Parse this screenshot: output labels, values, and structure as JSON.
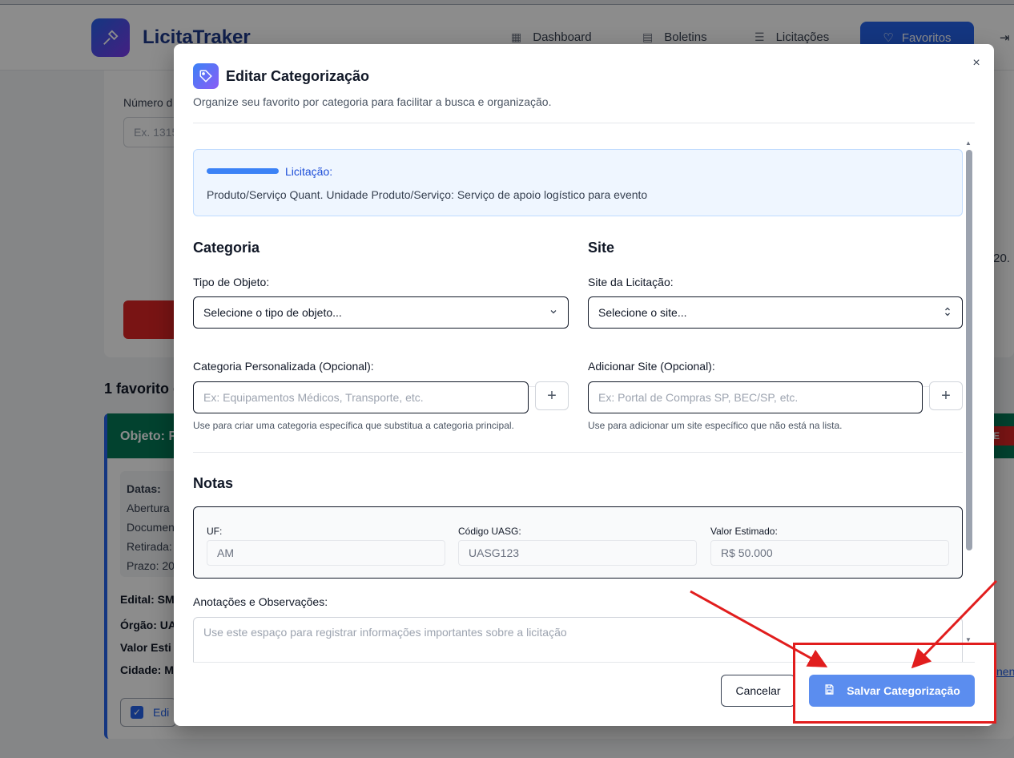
{
  "background": {
    "brand": "LicitaTraker",
    "nav": [
      {
        "icon": "dashboard-icon",
        "label": "Dashboard"
      },
      {
        "icon": "document-icon",
        "label": "Boletins"
      },
      {
        "icon": "list-icon",
        "label": "Licitações"
      }
    ],
    "favorites_label": "Favoritos",
    "filter_label": "Número d",
    "filter_placeholder": "Ex. 1315",
    "date_partial": "/20.",
    "count_text": "1 favorito e",
    "card_header": "Objeto: F",
    "badge": "E",
    "datas_lines": [
      "Datas:",
      "Abertura",
      "Documen",
      "Retirada:",
      "Prazo: 20"
    ],
    "fields": [
      "Edital: SM",
      "Órgão: UA",
      "Valor Esti",
      "Cidade: M"
    ],
    "edit_label": "Edi",
    "link_partial": "nen"
  },
  "modal": {
    "title": "Editar Categorização",
    "subtitle": "Organize seu favorito por categoria para facilitar a busca e organização.",
    "close": "×",
    "info": {
      "label": "Licitação:",
      "description": "Produto/Serviço Quant. Unidade Produto/Serviço: Serviço de apoio logístico para evento"
    },
    "categoria": {
      "heading": "Categoria",
      "tipo_label": "Tipo de Objeto:",
      "tipo_value": "Selecione o tipo de objeto...",
      "custom_label": "Categoria Personalizada (Opcional):",
      "custom_placeholder": "Ex: Equipamentos Médicos, Transporte, etc.",
      "custom_hint": "Use para criar uma categoria específica que substitua a categoria principal."
    },
    "site": {
      "heading": "Site",
      "site_label": "Site da Licitação:",
      "site_value": "Selecione o site...",
      "add_label": "Adicionar Site (Opcional):",
      "add_placeholder": "Ex: Portal de Compras SP, BEC/SP, etc.",
      "add_hint": "Use para adicionar um site específico que não está na lista."
    },
    "notas": {
      "heading": "Notas",
      "uf_label": "UF:",
      "uf_value": "AM",
      "uasg_label": "Código UASG:",
      "uasg_value": "UASG123",
      "valor_label": "Valor Estimado:",
      "valor_value": "R$ 50.000",
      "obs_label": "Anotações e Observações:",
      "obs_placeholder": "Use este espaço para registrar informações importantes sobre a licitação"
    },
    "footer": {
      "cancel": "Cancelar",
      "save": "Salvar Categorização"
    }
  },
  "colors": {
    "primary": "#5b8def",
    "annotation": "#e11d1d"
  }
}
